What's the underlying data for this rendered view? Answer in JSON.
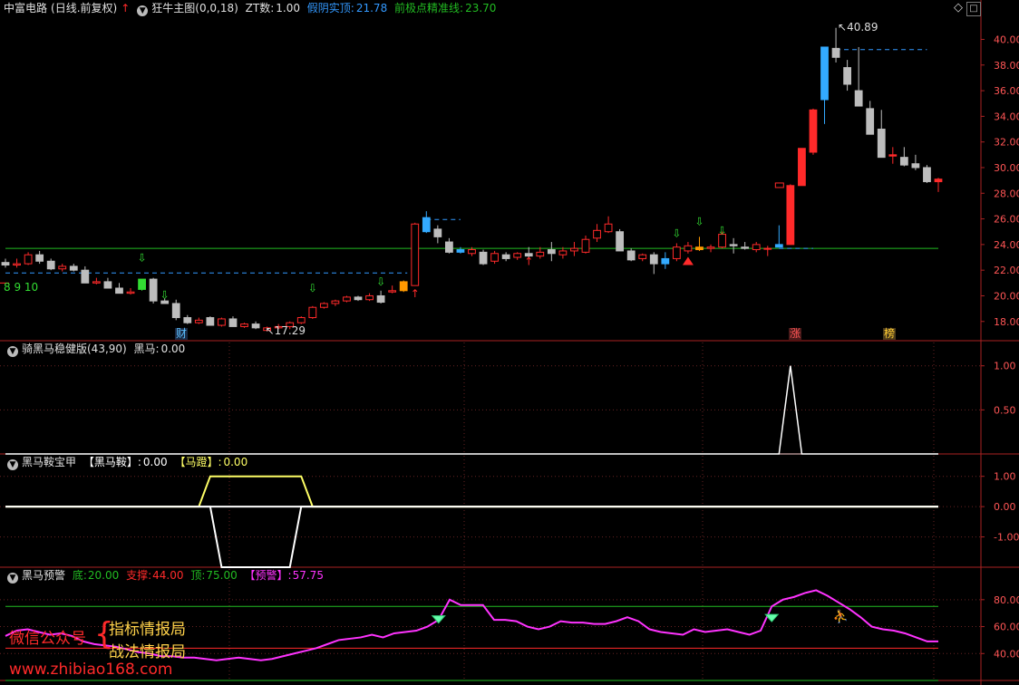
{
  "header": {
    "stock_name": "中富电路",
    "period": "(日线.前复权)",
    "indicator": "狂牛主图(0,0,18)",
    "zt_label": "ZT数:",
    "zt_value": "1.00",
    "fake_label": "假阴实顶:",
    "fake_value": "21.78",
    "base_label": "前极点精准线:",
    "base_value": "23.70"
  },
  "panels": {
    "p2_title": "骑黑马稳健版(43,90)",
    "p2_label": "黑马:",
    "p2_value": "0.00",
    "p3_title": "黑马鞍宝甲",
    "p3_label1": "【黑马鞍】:",
    "p3_value1": "0.00",
    "p3_label2": "【马蹬】:",
    "p3_value2": "0.00",
    "p4_title": "黑马预警",
    "p4_bottom_label": "底:",
    "p4_bottom": "20.00",
    "p4_support_label": "支撑:",
    "p4_support": "44.00",
    "p4_top_label": "顶:",
    "p4_top": "75.00",
    "p4_alert_label": "【预警】:",
    "p4_alert": "57.75"
  },
  "icons": {
    "collapse": "triangle-down-icon",
    "up_arrow": "red-up-arrow-icon",
    "gear": "gear-icon"
  },
  "markers": {
    "high_label": "40.89",
    "low_label": "17.29",
    "counts": "8  9  10",
    "event_cai": "财",
    "event_zhang": "涨",
    "event_bang": "榜"
  },
  "watermark": {
    "line1": "微信公众号",
    "line2": "指标情报局",
    "line3": "战法情报局",
    "line4": "www.zhibiao168.com"
  },
  "colors": {
    "up": "#ff2a2a",
    "down": "#bdbdbd",
    "pink": "#ff33ff",
    "yellow": "#ffff66",
    "green": "#22bb22",
    "blue": "#3399ff"
  },
  "chart_data": [
    {
      "type": "candlestick",
      "title": "狂牛主图",
      "ylim": [
        16.5,
        41.8
      ],
      "yticks": [
        18,
        20,
        22,
        24,
        26,
        28,
        30,
        32,
        34,
        36,
        38,
        40
      ],
      "ytick_labels": [
        "18.00",
        "20.00",
        "22.00",
        "24.00",
        "26.00",
        "28.00",
        "30.00",
        "32.00",
        "34.00",
        "36.00",
        "38.00",
        "40.00"
      ],
      "reference_lines": {
        "base_line": 23.7,
        "dashed_left": 21.78,
        "dashed_right": 39.2
      },
      "series": [
        {
          "name": "K",
          "ohlc": [
            [
              22.6,
              22.9,
              22.2,
              22.4
            ],
            [
              22.4,
              22.9,
              22.2,
              22.5
            ],
            [
              22.5,
              23.4,
              22.4,
              23.2
            ],
            [
              23.2,
              23.5,
              22.5,
              22.7
            ],
            [
              22.7,
              22.9,
              22.0,
              22.1
            ],
            [
              22.1,
              22.5,
              21.9,
              22.3
            ],
            [
              22.3,
              22.5,
              21.9,
              22.0
            ],
            [
              22.0,
              22.3,
              21.0,
              21.0
            ],
            [
              21.0,
              21.4,
              20.9,
              21.1
            ],
            [
              21.1,
              21.4,
              20.8,
              20.6
            ],
            [
              20.6,
              21.0,
              20.3,
              20.2
            ],
            [
              20.2,
              20.6,
              20.1,
              20.3
            ],
            [
              20.5,
              21.3,
              20.4,
              21.3
            ],
            [
              21.3,
              21.4,
              19.4,
              19.6
            ],
            [
              19.6,
              19.8,
              19.4,
              19.4
            ],
            [
              19.4,
              19.7,
              18.1,
              18.3
            ],
            [
              18.3,
              18.5,
              17.8,
              17.9
            ],
            [
              17.9,
              18.3,
              17.8,
              18.1
            ],
            [
              18.3,
              18.4,
              17.7,
              17.7
            ],
            [
              17.7,
              18.3,
              17.6,
              18.2
            ],
            [
              18.2,
              18.4,
              17.6,
              17.6
            ],
            [
              17.6,
              17.9,
              17.5,
              17.8
            ],
            [
              17.8,
              18.0,
              17.4,
              17.5
            ],
            [
              17.3,
              17.6,
              17.3,
              17.5
            ],
            [
              17.5,
              17.8,
              17.4,
              17.6
            ],
            [
              17.6,
              18.0,
              17.4,
              17.9
            ],
            [
              17.9,
              18.4,
              17.8,
              18.3
            ],
            [
              18.3,
              19.2,
              18.2,
              19.1
            ],
            [
              19.1,
              19.5,
              19.0,
              19.4
            ],
            [
              19.4,
              19.7,
              19.2,
              19.6
            ],
            [
              19.6,
              20.0,
              19.5,
              19.9
            ],
            [
              19.9,
              20.0,
              19.6,
              19.7
            ],
            [
              19.7,
              20.2,
              19.6,
              20.0
            ],
            [
              20.0,
              20.4,
              19.4,
              19.5
            ],
            [
              20.3,
              20.8,
              20.2,
              20.4
            ],
            [
              20.4,
              21.2,
              20.3,
              21.1
            ],
            [
              20.8,
              25.7,
              20.8,
              25.6
            ],
            [
              25.0,
              26.6,
              24.9,
              26.1
            ],
            [
              25.2,
              25.5,
              24.1,
              24.6
            ],
            [
              24.2,
              24.5,
              23.3,
              23.4
            ],
            [
              23.4,
              23.8,
              23.3,
              23.6
            ],
            [
              23.3,
              23.8,
              23.1,
              23.6
            ],
            [
              23.4,
              23.6,
              22.4,
              22.5
            ],
            [
              22.7,
              23.5,
              22.5,
              23.3
            ],
            [
              23.2,
              23.4,
              22.7,
              22.9
            ],
            [
              23.0,
              23.4,
              22.8,
              23.3
            ],
            [
              23.3,
              23.8,
              22.9,
              23.1
            ],
            [
              23.1,
              23.8,
              22.9,
              23.4
            ],
            [
              23.6,
              24.2,
              22.7,
              23.3
            ],
            [
              23.2,
              23.8,
              22.9,
              23.5
            ],
            [
              23.5,
              24.2,
              23.1,
              23.7
            ],
            [
              23.4,
              24.7,
              23.3,
              24.4
            ],
            [
              24.5,
              25.6,
              24.2,
              25.1
            ],
            [
              25.0,
              26.2,
              24.9,
              25.6
            ],
            [
              25.0,
              25.2,
              23.5,
              23.5
            ],
            [
              23.5,
              23.7,
              22.7,
              22.8
            ],
            [
              22.9,
              23.3,
              22.7,
              23.2
            ],
            [
              23.2,
              23.4,
              21.7,
              22.5
            ],
            [
              22.5,
              23.4,
              22.1,
              22.9
            ],
            [
              22.9,
              24.1,
              22.7,
              23.8
            ],
            [
              23.5,
              24.2,
              23.3,
              23.9
            ],
            [
              23.8,
              24.6,
              23.5,
              23.6
            ],
            [
              23.7,
              24.0,
              23.4,
              23.8
            ],
            [
              23.8,
              25.0,
              23.7,
              24.8
            ],
            [
              24.0,
              24.5,
              23.3,
              23.9
            ],
            [
              23.8,
              24.2,
              23.6,
              23.7
            ],
            [
              23.6,
              24.2,
              23.4,
              24.0
            ],
            [
              23.7,
              23.9,
              23.1,
              23.7
            ],
            [
              23.8,
              25.5,
              23.8,
              24.0
            ],
            [
              24.0,
              28.7,
              24.0,
              28.6
            ],
            [
              28.6,
              31.5,
              28.6,
              31.5
            ],
            [
              31.2,
              34.6,
              31.0,
              34.5
            ],
            [
              35.3,
              39.4,
              33.4,
              39.4
            ],
            [
              39.3,
              40.9,
              38.2,
              38.6
            ],
            [
              37.8,
              38.4,
              36.0,
              36.5
            ],
            [
              36.0,
              39.4,
              35.1,
              34.8
            ],
            [
              34.6,
              35.2,
              32.8,
              32.6
            ],
            [
              33.0,
              34.5,
              30.9,
              30.8
            ],
            [
              30.9,
              31.6,
              30.3,
              31.0
            ],
            [
              30.8,
              31.6,
              30.1,
              30.2
            ],
            [
              30.3,
              31.0,
              29.8,
              30.0
            ],
            [
              30.0,
              30.2,
              28.8,
              28.9
            ],
            [
              28.9,
              29.2,
              28.1,
              29.1
            ]
          ]
        }
      ]
    },
    {
      "type": "line",
      "title": "骑黑马稳健版",
      "ylim": [
        0,
        1.1
      ],
      "yticks": [
        0.5,
        1.0
      ],
      "ytick_labels": [
        "0.50",
        "1.00"
      ],
      "series": [
        {
          "name": "黑马",
          "values": [
            0,
            0,
            0,
            0,
            0,
            0,
            0,
            0,
            0,
            0,
            0,
            0,
            0,
            0,
            0,
            0,
            0,
            0,
            0,
            0,
            0,
            0,
            0,
            0,
            0,
            0,
            0,
            0,
            0,
            0,
            0,
            0,
            0,
            0,
            0,
            0,
            0,
            0,
            0,
            0,
            0,
            0,
            0,
            0,
            0,
            0,
            0,
            0,
            0,
            0,
            0,
            0,
            0,
            0,
            0,
            0,
            0,
            0,
            0,
            0,
            0,
            0,
            0,
            0,
            0,
            0,
            0,
            0,
            0,
            1,
            0,
            0,
            0,
            0,
            0,
            0,
            0,
            0,
            0,
            0,
            0,
            0,
            0
          ]
        }
      ]
    },
    {
      "type": "line",
      "title": "黑马鞍宝甲",
      "ylim": [
        -2.0,
        1.2
      ],
      "yticks": [
        -1.0,
        0.0,
        1.0
      ],
      "ytick_labels": [
        "-1.00",
        "0.00",
        "1.00"
      ],
      "series": [
        {
          "name": "【黑马鞍】",
          "values": [
            0,
            0,
            0,
            0,
            0,
            0,
            0,
            0,
            0,
            0,
            0,
            0,
            0,
            0,
            0,
            0,
            0,
            0,
            0,
            0,
            0,
            0,
            0,
            0,
            0,
            0,
            0,
            0,
            0,
            0,
            0,
            0,
            0,
            0,
            0,
            0,
            0,
            0,
            0,
            0,
            0,
            0,
            0,
            0,
            0,
            0,
            0,
            0,
            0,
            0,
            0,
            0,
            0,
            0,
            0,
            0,
            0,
            0,
            0,
            0,
            0,
            0,
            0,
            0,
            0,
            0,
            0,
            0,
            0,
            0,
            0,
            0,
            0,
            0,
            0,
            0,
            0,
            0,
            0,
            0,
            0,
            0,
            0
          ]
        },
        {
          "name": "【马蹬】",
          "values": [
            0,
            0,
            0,
            0,
            0,
            0,
            0,
            0,
            0,
            0,
            0,
            0,
            0,
            0,
            0,
            0,
            0,
            0,
            1,
            1,
            1,
            1,
            1,
            1,
            1,
            1,
            1,
            0,
            0,
            0,
            0,
            0,
            0,
            0,
            0,
            0,
            0,
            0,
            0,
            0,
            0,
            0,
            0,
            0,
            0,
            0,
            0,
            0,
            0,
            0,
            0,
            0,
            0,
            0,
            0,
            0,
            0,
            0,
            0,
            0,
            0,
            0,
            0,
            0,
            0,
            0,
            0,
            0,
            0,
            0,
            0,
            0,
            0,
            0,
            0,
            0,
            0,
            0,
            0,
            0,
            0,
            0,
            0
          ]
        },
        {
          "name": "down",
          "values": [
            0,
            0,
            0,
            0,
            0,
            0,
            0,
            0,
            0,
            0,
            0,
            0,
            0,
            0,
            0,
            0,
            0,
            0,
            0,
            -2,
            -2,
            -2,
            -2,
            -2,
            -2,
            -2,
            0,
            0,
            0,
            0,
            0,
            0,
            0,
            0,
            0,
            0,
            0,
            0,
            0,
            0,
            0,
            0,
            0,
            0,
            0,
            0,
            0,
            0,
            0,
            0,
            0,
            0,
            0,
            0,
            0,
            0,
            0,
            0,
            0,
            0,
            0,
            0,
            0,
            0,
            0,
            0,
            0,
            0,
            0,
            0,
            0,
            0,
            0,
            0,
            0,
            0,
            0,
            0,
            0,
            0,
            0,
            0,
            0
          ]
        }
      ]
    },
    {
      "type": "line",
      "title": "黑马预警",
      "ylim": [
        20,
        92
      ],
      "yticks": [
        40,
        60,
        80
      ],
      "ytick_labels": [
        "40.00",
        "60.00",
        "80.00"
      ],
      "reference_lines": {
        "bottom": 20,
        "support": 44,
        "top": 75
      },
      "series": [
        {
          "name": "【预警】",
          "values": [
            53,
            57,
            58,
            56,
            54,
            55,
            53,
            49,
            47,
            46,
            45,
            43,
            41,
            40,
            38,
            38,
            37,
            37,
            36,
            35,
            36,
            37,
            36,
            35,
            36,
            38,
            40,
            42,
            44,
            47,
            50,
            51,
            52,
            54,
            52,
            55,
            56,
            57,
            60,
            65,
            80,
            76,
            76,
            76,
            65,
            65,
            64,
            60,
            58,
            60,
            64,
            63,
            63,
            62,
            62,
            64,
            67,
            64,
            58,
            56,
            55,
            54,
            58,
            56,
            57,
            58,
            56,
            54,
            57,
            75,
            80,
            82,
            85,
            87,
            83,
            78,
            73,
            67,
            60,
            58,
            57,
            55,
            52,
            49,
            49
          ]
        }
      ]
    }
  ]
}
